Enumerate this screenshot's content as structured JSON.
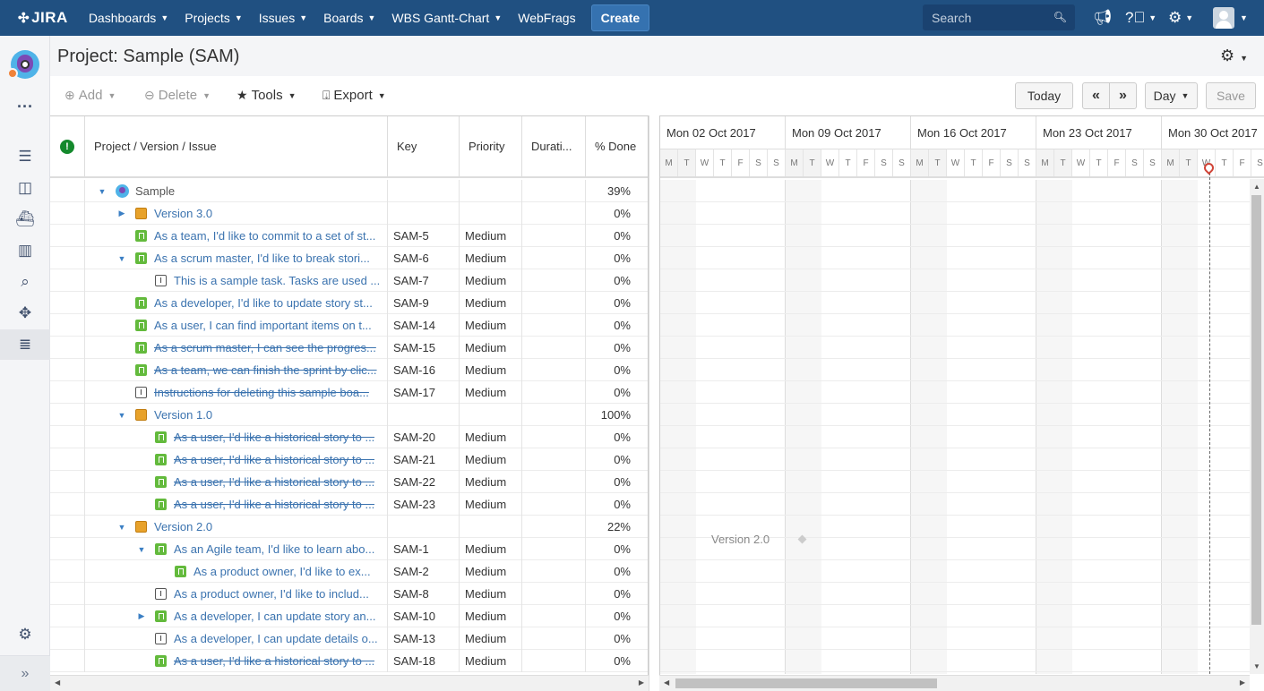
{
  "nav": {
    "logo": "JIRA",
    "items": [
      "Dashboards",
      "Projects",
      "Issues",
      "Boards",
      "WBS Gantt-Chart"
    ],
    "webfrags": "WebFrags",
    "create": "Create",
    "search_placeholder": "Search"
  },
  "icons": {
    "search": "search-icon",
    "notify": "megaphone-icon",
    "help": "help-icon",
    "settings": "gear-icon",
    "user": "avatar"
  },
  "header": {
    "title": "Project:  Sample (SAM)"
  },
  "toolbar": {
    "add": "Add",
    "delete": "Delete",
    "tools": "Tools",
    "export": "Export",
    "today": "Today",
    "prev": "«",
    "next": "»",
    "scale": "Day",
    "save": "Save"
  },
  "columns": {
    "name": "Project / Version / Issue",
    "key": "Key",
    "priority": "Priority",
    "duration": "Durati...",
    "done": "% Done"
  },
  "rows": [
    {
      "level": 0,
      "toggle": "down",
      "icon": "project",
      "name": "Sample",
      "key": "",
      "priority": "",
      "done": "39%",
      "resolved": false
    },
    {
      "level": 1,
      "toggle": "right",
      "icon": "version",
      "name": "Version 3.0",
      "key": "",
      "priority": "",
      "done": "0%",
      "resolved": false
    },
    {
      "level": 1,
      "toggle": "",
      "icon": "story",
      "name": "As a team, I'd like to commit to a set of st...",
      "key": "SAM-5",
      "priority": "Medium",
      "done": "0%",
      "resolved": false
    },
    {
      "level": 1,
      "toggle": "down",
      "icon": "story",
      "name": "As a scrum master, I'd like to break stori...",
      "key": "SAM-6",
      "priority": "Medium",
      "done": "0%",
      "resolved": false
    },
    {
      "level": 2,
      "toggle": "",
      "icon": "task",
      "name": "This is a sample task. Tasks are used ...",
      "key": "SAM-7",
      "priority": "Medium",
      "done": "0%",
      "resolved": false
    },
    {
      "level": 1,
      "toggle": "",
      "icon": "story",
      "name": "As a developer, I'd like to update story st...",
      "key": "SAM-9",
      "priority": "Medium",
      "done": "0%",
      "resolved": false
    },
    {
      "level": 1,
      "toggle": "",
      "icon": "story",
      "name": "As a user, I can find important items on t...",
      "key": "SAM-14",
      "priority": "Medium",
      "done": "0%",
      "resolved": false
    },
    {
      "level": 1,
      "toggle": "",
      "icon": "story",
      "name": "As a scrum master, I can see the progres...",
      "key": "SAM-15",
      "priority": "Medium",
      "done": "0%",
      "resolved": true
    },
    {
      "level": 1,
      "toggle": "",
      "icon": "story",
      "name": "As a team, we can finish the sprint by clic...",
      "key": "SAM-16",
      "priority": "Medium",
      "done": "0%",
      "resolved": true
    },
    {
      "level": 1,
      "toggle": "",
      "icon": "task",
      "name": "Instructions for deleting this sample boa...",
      "key": "SAM-17",
      "priority": "Medium",
      "done": "0%",
      "resolved": true
    },
    {
      "level": 1,
      "toggle": "down",
      "icon": "version",
      "name": "Version 1.0",
      "key": "",
      "priority": "",
      "done": "100%",
      "resolved": false
    },
    {
      "level": 2,
      "toggle": "",
      "icon": "story",
      "name": "As a user, I'd like a historical story to ...",
      "key": "SAM-20",
      "priority": "Medium",
      "done": "0%",
      "resolved": true
    },
    {
      "level": 2,
      "toggle": "",
      "icon": "story",
      "name": "As a user, I'd like a historical story to ...",
      "key": "SAM-21",
      "priority": "Medium",
      "done": "0%",
      "resolved": true
    },
    {
      "level": 2,
      "toggle": "",
      "icon": "story",
      "name": "As a user, I'd like a historical story to ...",
      "key": "SAM-22",
      "priority": "Medium",
      "done": "0%",
      "resolved": true
    },
    {
      "level": 2,
      "toggle": "",
      "icon": "story",
      "name": "As a user, I'd like a historical story to ...",
      "key": "SAM-23",
      "priority": "Medium",
      "done": "0%",
      "resolved": true
    },
    {
      "level": 1,
      "toggle": "down",
      "icon": "version",
      "name": "Version 2.0",
      "key": "",
      "priority": "",
      "done": "22%",
      "resolved": false
    },
    {
      "level": 2,
      "toggle": "down",
      "icon": "story",
      "name": "As an Agile team, I'd like to learn abo...",
      "key": "SAM-1",
      "priority": "Medium",
      "done": "0%",
      "resolved": false
    },
    {
      "level": 3,
      "toggle": "",
      "icon": "story",
      "name": "As a product owner, I'd like to ex...",
      "key": "SAM-2",
      "priority": "Medium",
      "done": "0%",
      "resolved": false
    },
    {
      "level": 2,
      "toggle": "",
      "icon": "task",
      "name": "As a product owner, I'd like to includ...",
      "key": "SAM-8",
      "priority": "Medium",
      "done": "0%",
      "resolved": false
    },
    {
      "level": 2,
      "toggle": "right",
      "icon": "story",
      "name": "As a developer, I can update story an...",
      "key": "SAM-10",
      "priority": "Medium",
      "done": "0%",
      "resolved": false
    },
    {
      "level": 2,
      "toggle": "",
      "icon": "task",
      "name": "As a developer, I can update details o...",
      "key": "SAM-13",
      "priority": "Medium",
      "done": "0%",
      "resolved": false
    },
    {
      "level": 2,
      "toggle": "",
      "icon": "story",
      "name": "As a user, I'd like a historical story to ...",
      "key": "SAM-18",
      "priority": "Medium",
      "done": "0%",
      "resolved": true
    }
  ],
  "gantt": {
    "weeks": [
      "Mon 02 Oct 2017",
      "Mon 09 Oct 2017",
      "Mon 16 Oct 2017",
      "Mon 23 Oct 2017",
      "Mon 30 Oct 2017"
    ],
    "days": [
      "M",
      "T",
      "W",
      "T",
      "F",
      "S",
      "S"
    ],
    "version_label": "Version 2.0"
  }
}
